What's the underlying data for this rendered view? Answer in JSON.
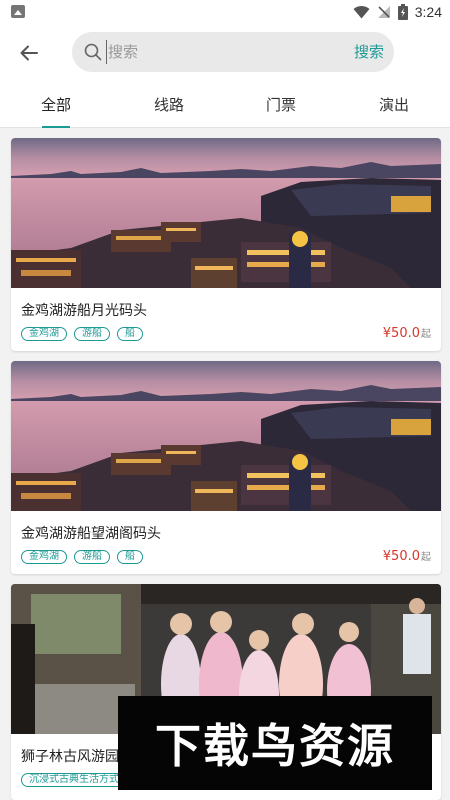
{
  "status": {
    "time": "3:24",
    "battery_icon": "battery-icon",
    "wifi_icon": "wifi-icon",
    "signal_icon": "no-signal-icon"
  },
  "search": {
    "placeholder": "搜索",
    "value": "",
    "button_label": "搜索"
  },
  "tabs": [
    {
      "label": "全部",
      "active": true
    },
    {
      "label": "线路",
      "active": false
    },
    {
      "label": "门票",
      "active": false
    },
    {
      "label": "演出",
      "active": false
    }
  ],
  "items": [
    {
      "title": "金鸡湖游船月光码头",
      "tags": [
        "金鸡湖",
        "游船",
        "船"
      ],
      "price": "¥50.0",
      "price_unit": "起",
      "image": "lake-night-harbor-photo"
    },
    {
      "title": "金鸡湖游船望湖阁码头",
      "tags": [
        "金鸡湖",
        "游船",
        "船"
      ],
      "price": "¥50.0",
      "price_unit": "起",
      "image": "lake-night-harbor-photo"
    },
    {
      "title": "狮子林古风游园",
      "tags": [
        "沉浸式古典生活方式"
      ],
      "image": "hanfu-garden-performers-photo"
    }
  ],
  "watermark": {
    "text": "下载鸟资源"
  },
  "colors": {
    "accent": "#1e9a95",
    "price": "#d9352b",
    "background": "#f2f2f2"
  }
}
